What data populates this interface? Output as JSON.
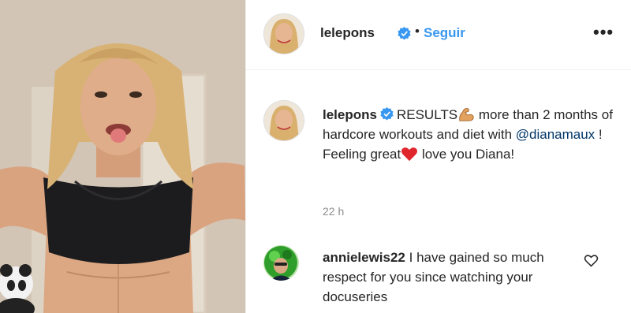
{
  "post": {
    "photo_alt": "Post photo"
  },
  "header": {
    "username": "lelepons",
    "separator": "•",
    "follow_label": "Seguir",
    "more_label": "•••"
  },
  "caption": {
    "username": "lelepons",
    "text_part1": "RESULTS",
    "text_part2": " more than 2 months of hardcore workouts and diet with ",
    "mention": "@dianamaux",
    "text_part3": " ! Feeling great",
    "text_part4": " love you Diana!",
    "time": "22 h"
  },
  "comment": {
    "username": "annielewis22",
    "text": "I have gained so much respect for you since watching your docuseries"
  },
  "colors": {
    "link": "#3897f0",
    "mention": "#003569",
    "meta": "#8e8e8e",
    "verified": "#3897f0"
  },
  "icons": {
    "verified": "verified-badge-icon",
    "flexed_biceps": "flexed-biceps-emoji",
    "red_heart": "red-heart-emoji",
    "like": "heart-outline-icon",
    "more": "more-options-icon"
  }
}
